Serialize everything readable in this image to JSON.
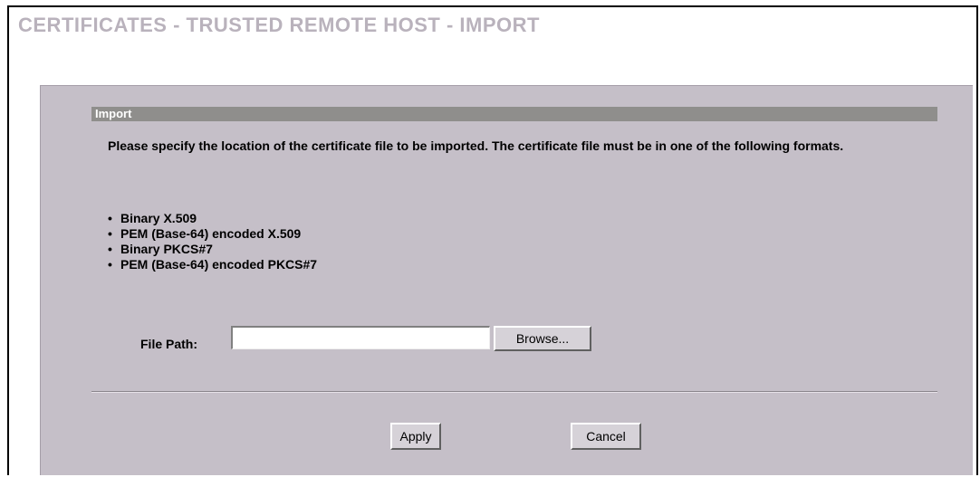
{
  "page": {
    "title": "CERTIFICATES - TRUSTED REMOTE HOST - IMPORT"
  },
  "import_section": {
    "title": "Import",
    "description": "Please specify the location of the certificate file to be imported. The certificate file must be in one of the following formats.",
    "formats": [
      "Binary X.509",
      "PEM (Base-64) encoded X.509",
      "Binary PKCS#7",
      "PEM (Base-64) encoded PKCS#7"
    ],
    "file_path_label": "File Path:",
    "file_path_value": "",
    "browse_label": "Browse..."
  },
  "actions": {
    "apply_label": "Apply",
    "cancel_label": "Cancel"
  },
  "colors": {
    "title": "#b9b2bc",
    "panel_background": "#c5bfc8",
    "section_bar": "#8f8e8c"
  }
}
